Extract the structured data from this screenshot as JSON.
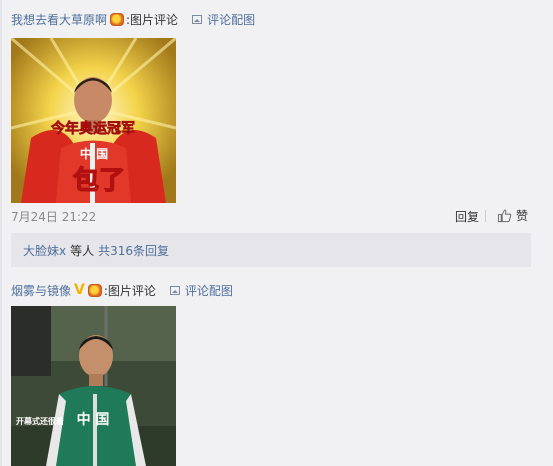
{
  "comments": [
    {
      "username": "我想去看大草原啊",
      "colon_text": ":图片评论",
      "pic_link": "评论配图",
      "image": {
        "banner": "今年奥运冠军",
        "chest": "中 国",
        "caption": "包了"
      },
      "timestamp": "7月24日 21:22",
      "reply_label": "回复",
      "like_label": "赞",
      "replies": {
        "replier": "大脸妹x",
        "etc": "等人",
        "total": "共316条回复"
      }
    },
    {
      "username": "烟雾与镜像",
      "vip_mark": "V",
      "colon_text": ":图片评论",
      "pic_link": "评论配图",
      "image": {
        "side_text": "开幕式还很着",
        "chest": "中 国"
      }
    }
  ],
  "colors": {
    "link": "#4f6f9a",
    "background": "#f1f1f4",
    "reply_box": "#e6e6ea",
    "vip": "#f4b400"
  },
  "icons": [
    "medal-badge-icon",
    "picture-icon",
    "thumbs-up-icon",
    "vip-icon"
  ]
}
